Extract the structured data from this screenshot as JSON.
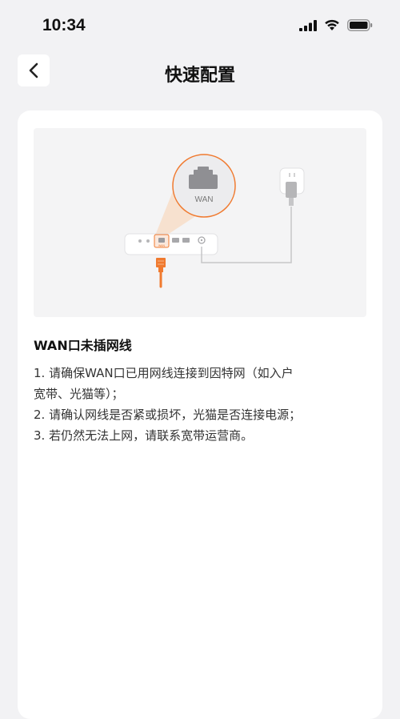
{
  "status_bar": {
    "time": "10:34",
    "icons": [
      "signal-icon",
      "wifi-icon",
      "battery-icon"
    ]
  },
  "nav": {
    "back_icon": "chevron-left-icon",
    "title": "快速配置"
  },
  "illustration": {
    "wan_label": "WAN",
    "router_port_label": "WAN",
    "accent_color": "#f07a2f",
    "icons": [
      "router-icon",
      "ethernet-port-icon",
      "power-adapter-icon",
      "ethernet-cable-icon"
    ]
  },
  "content": {
    "title": "WAN口未插网线",
    "steps": [
      "1. 请确保WAN口已用网线连接到因特网（如入户",
      "宽带、光猫等）；",
      "2. 请确认网线是否紧或损坏，光猫是否连接电源；",
      "3. 若仍然无法上网，请联系宽带运营商。"
    ]
  }
}
